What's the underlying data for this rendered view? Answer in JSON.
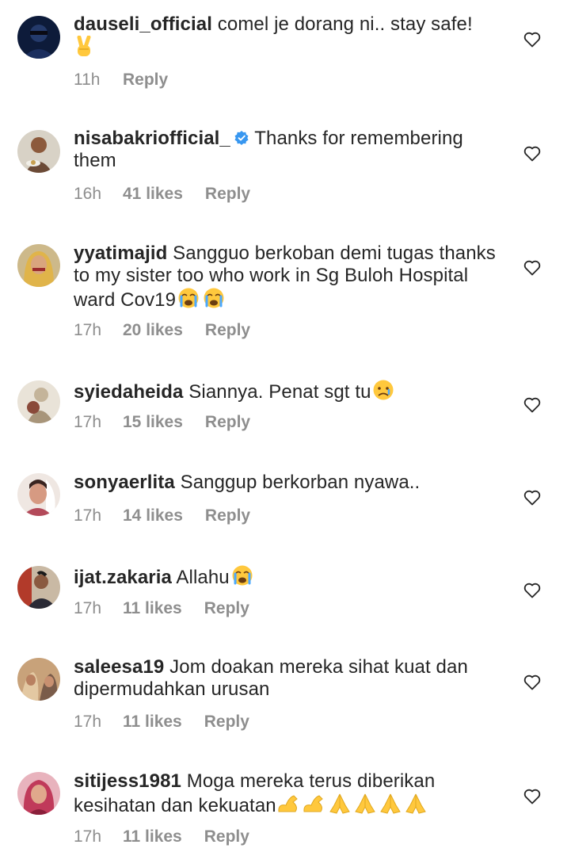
{
  "comments": [
    {
      "username": "dauseli_official",
      "verified": false,
      "text": "comel je dorang ni.. stay safe!",
      "emoji_after": [
        "victory-hand"
      ],
      "time": "11h",
      "likes": "",
      "reply": "Reply"
    },
    {
      "username": "nisabakriofficial_",
      "verified": true,
      "text": "Thanks for remembering them",
      "emoji_after": [],
      "time": "16h",
      "likes": "41 likes",
      "reply": "Reply"
    },
    {
      "username": "yyatimajid",
      "verified": false,
      "text": "Sangguo berkoban demi tugas thanks to my sister too who work in Sg Buloh Hospital ward Cov19",
      "emoji_after": [
        "crying-face",
        "crying-face"
      ],
      "time": "17h",
      "likes": "20 likes",
      "reply": "Reply"
    },
    {
      "username": "syiedaheida",
      "verified": false,
      "text": "Siannya. Penat sgt tu",
      "emoji_after": [
        "sad-face"
      ],
      "time": "17h",
      "likes": "15 likes",
      "reply": "Reply"
    },
    {
      "username": "sonyaerlita",
      "verified": false,
      "text": "Sanggup berkorban nyawa..",
      "emoji_after": [],
      "time": "17h",
      "likes": "14 likes",
      "reply": "Reply"
    },
    {
      "username": "ijat.zakaria",
      "verified": false,
      "text": "Allahu",
      "emoji_after": [
        "crying-face"
      ],
      "time": "17h",
      "likes": "11 likes",
      "reply": "Reply"
    },
    {
      "username": "saleesa19",
      "verified": false,
      "text": "Jom doakan mereka sihat kuat dan dipermudahkan urusan",
      "emoji_after": [],
      "time": "17h",
      "likes": "11 likes",
      "reply": "Reply"
    },
    {
      "username": "sitijess1981",
      "verified": false,
      "text": "Moga mereka terus diberikan kesihatan dan kekuatan",
      "emoji_after": [
        "flexed-biceps",
        "flexed-biceps",
        "folded-hands",
        "folded-hands",
        "folded-hands",
        "folded-hands"
      ],
      "time": "17h",
      "likes": "11 likes",
      "reply": "Reply"
    }
  ],
  "colors": {
    "text": "#262626",
    "meta": "#8e8e8e",
    "verified": "#3897f0",
    "emoji_yellow": "#ffc83d"
  }
}
